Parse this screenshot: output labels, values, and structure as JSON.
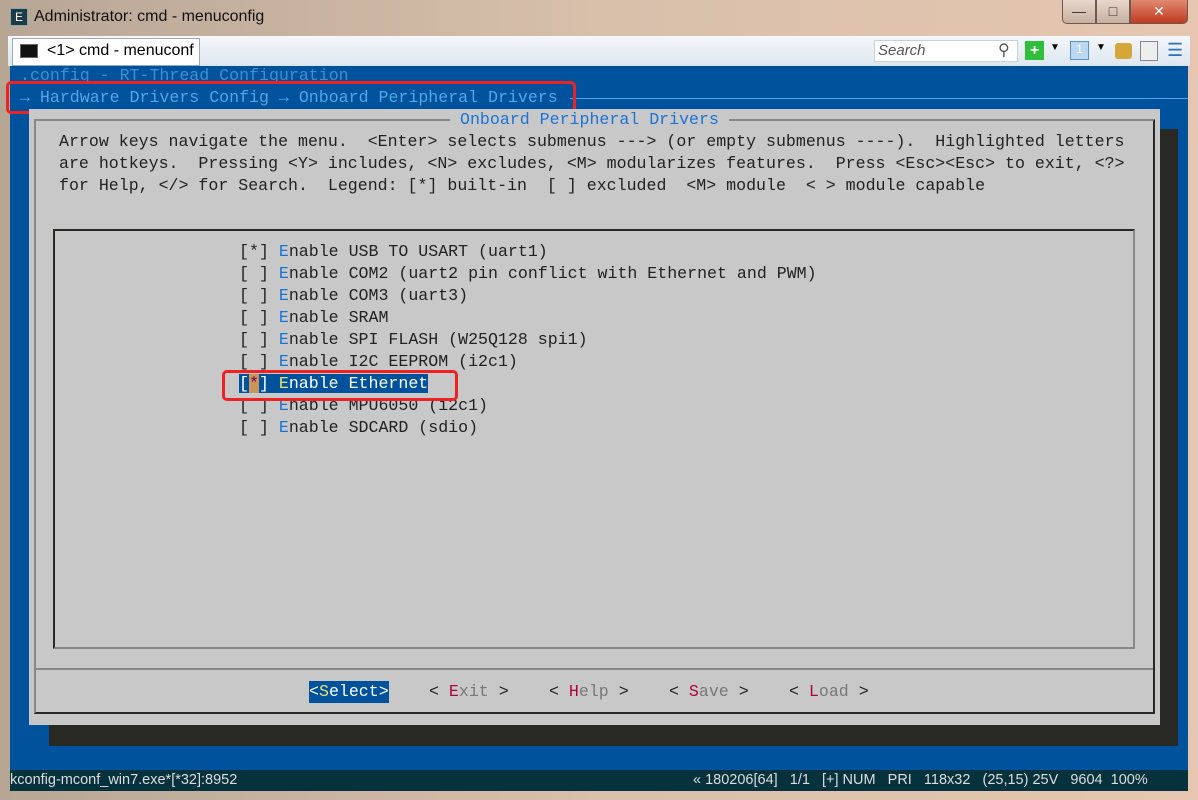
{
  "window": {
    "title": "Administrator: cmd - menuconfig",
    "buttons": [
      "minimize",
      "maximize",
      "close"
    ]
  },
  "tab": {
    "label": "<1> cmd - menuconf"
  },
  "toolbar": {
    "search_placeholder": "Search",
    "icons": [
      "search-icon",
      "add-console-icon",
      "dropdown-icon",
      "console-number-icon",
      "dropdown-icon",
      "lock-icon",
      "panel-icon",
      "menu-icon"
    ]
  },
  "terminal": {
    "config_line": ".config - RT-Thread Configuration",
    "breadcrumb": "→ Hardware Drivers Config → Onboard Peripheral Drivers",
    "dialog_title": "Onboard Peripheral Drivers",
    "help": [
      "Arrow keys navigate the menu.  <Enter> selects submenus ---> (or empty submenus ----).  Highlighted letters",
      "are hotkeys.  Pressing <Y> includes, <N> excludes, <M> modularizes features.  Press <Esc><Esc> to exit, <?>",
      "for Help, </> for Search.  Legend: [*] built-in  [ ] excluded  <M> module  < > module capable"
    ],
    "items": [
      {
        "mark": "*",
        "hotkey": "E",
        "rest": "nable USB TO USART (uart1)",
        "selected": false
      },
      {
        "mark": " ",
        "hotkey": "E",
        "rest": "nable COM2 (uart2 pin conflict with Ethernet and PWM)",
        "selected": false
      },
      {
        "mark": " ",
        "hotkey": "E",
        "rest": "nable COM3 (uart3)",
        "selected": false
      },
      {
        "mark": " ",
        "hotkey": "E",
        "rest": "nable SRAM",
        "selected": false
      },
      {
        "mark": " ",
        "hotkey": "E",
        "rest": "nable SPI FLASH (W25Q128 spi1)",
        "selected": false
      },
      {
        "mark": " ",
        "hotkey": "E",
        "rest": "nable I2C EEPROM (i2c1)",
        "selected": false
      },
      {
        "mark": "*",
        "hotkey": "E",
        "rest": "nable Ethernet",
        "selected": true
      },
      {
        "mark": " ",
        "hotkey": "E",
        "rest": "nable MPU6050 (i2c1)",
        "selected": false
      },
      {
        "mark": " ",
        "hotkey": "E",
        "rest": "nable SDCARD (sdio)",
        "selected": false
      }
    ],
    "buttons": [
      {
        "hotkey": "S",
        "rest": "elect",
        "selected": true
      },
      {
        "hotkey": "E",
        "rest": "xit",
        "selected": false
      },
      {
        "hotkey": "H",
        "rest": "elp",
        "selected": false
      },
      {
        "hotkey": "S",
        "rest": "ave",
        "selected": false
      },
      {
        "hotkey": "L",
        "rest": "oad",
        "selected": false
      }
    ]
  },
  "statusbar": {
    "left": "kconfig-mconf_win7.exe*[*32]:8952",
    "right": "« 180206[64]   1/1   [+] NUM   PRI   118x32   (25,15) 25V   9604  100%"
  },
  "colors": {
    "terminal_bg": "#01529c",
    "dialog_bg": "#c8c8c8",
    "hotkey": "#1a73d9",
    "highlight": "#ee2222"
  }
}
